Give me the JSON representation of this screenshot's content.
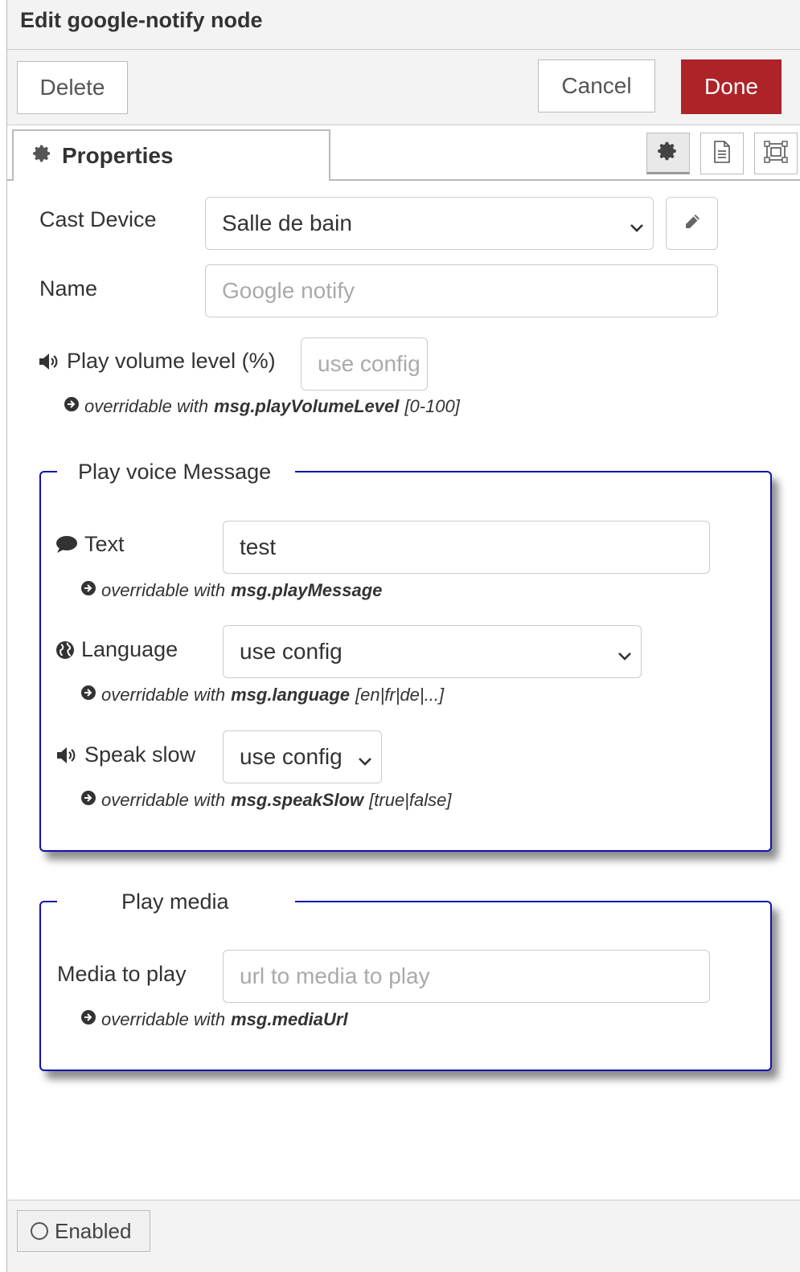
{
  "dialog": {
    "title": "Edit google-notify node"
  },
  "toolbar": {
    "delete_label": "Delete",
    "cancel_label": "Cancel",
    "done_label": "Done"
  },
  "tabs": {
    "properties_label": "Properties",
    "icon_tabs": [
      "gear-icon",
      "document-icon",
      "frame-icon"
    ]
  },
  "form": {
    "cast_device": {
      "label": "Cast Device",
      "value": "Salle de bain"
    },
    "name": {
      "label": "Name",
      "placeholder": "Google notify"
    },
    "volume": {
      "label": "Play volume level (%)",
      "placeholder": "use config",
      "hint_prefix": "overridable with",
      "hint_key": "msg.playVolumeLevel",
      "hint_range": "[0-100]"
    }
  },
  "voice_section": {
    "legend": "Play voice Message",
    "text": {
      "label": "Text",
      "value": "test",
      "hint_prefix": "overridable with",
      "hint_key": "msg.playMessage"
    },
    "language": {
      "label": "Language",
      "value": "use config",
      "hint_prefix": "overridable with",
      "hint_key": "msg.language",
      "hint_range": "[en|fr|de|...]"
    },
    "speak_slow": {
      "label": "Speak slow",
      "value": "use config",
      "hint_prefix": "overridable with",
      "hint_key": "msg.speakSlow",
      "hint_range": "[true|false]"
    }
  },
  "media_section": {
    "legend": "Play media",
    "media": {
      "label": "Media to play",
      "placeholder": "url to media to play",
      "hint_prefix": "overridable with",
      "hint_key": "msg.mediaUrl"
    }
  },
  "footer": {
    "enabled_label": "Enabled"
  },
  "colors": {
    "done_bg": "#ad2328",
    "fieldset_border": "#1010b0"
  }
}
